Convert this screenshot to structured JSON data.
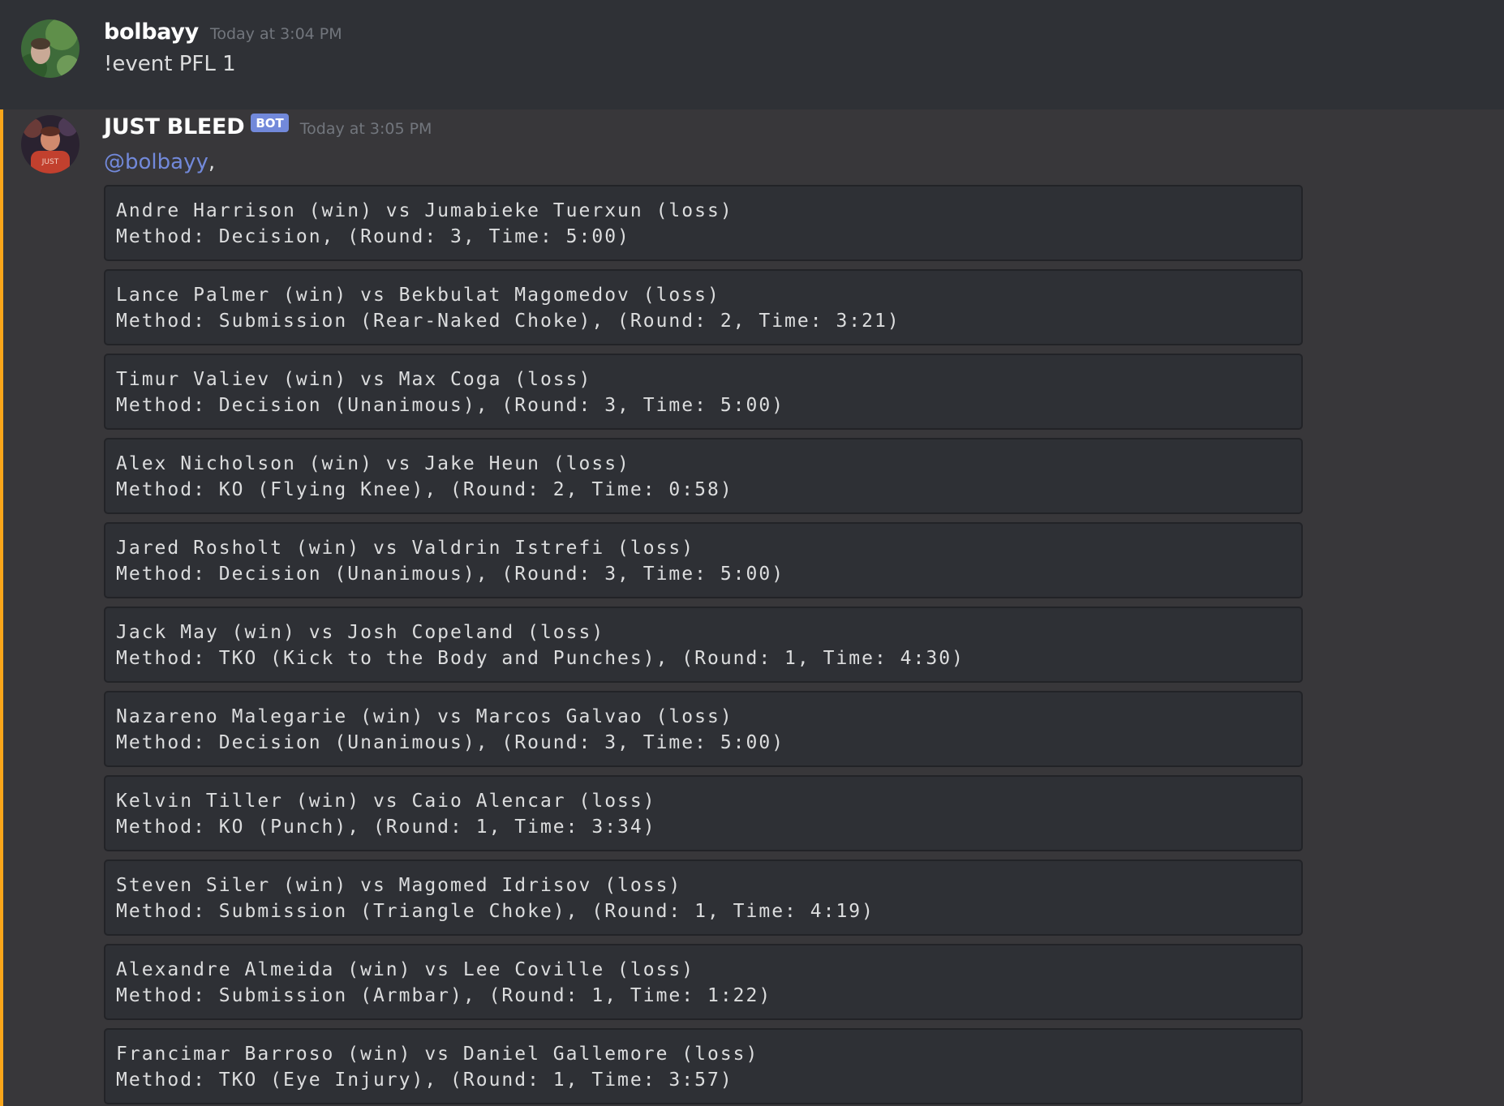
{
  "messages": [
    {
      "author": "bolbayy",
      "timestamp": "Today at 3:04 PM",
      "text": "!event PFL 1"
    },
    {
      "author": "JUST BLEED",
      "badge": "BOT",
      "timestamp": "Today at 3:05 PM",
      "mention": "@bolbayy",
      "mention_suffix": ",",
      "results": [
        {
          "fight": "Andre Harrison (win) vs Jumabieke Tuerxun (loss)",
          "method": "Method: Decision, (Round: 3, Time: 5:00)"
        },
        {
          "fight": "Lance Palmer (win) vs Bekbulat Magomedov (loss)",
          "method": "Method: Submission (Rear-Naked Choke), (Round: 2, Time: 3:21)"
        },
        {
          "fight": "Timur Valiev (win) vs Max Coga (loss)",
          "method": "Method: Decision (Unanimous), (Round: 3, Time: 5:00)"
        },
        {
          "fight": "Alex Nicholson (win) vs Jake Heun (loss)",
          "method": "Method: KO (Flying Knee), (Round: 2, Time: 0:58)"
        },
        {
          "fight": "Jared Rosholt (win) vs Valdrin Istrefi (loss)",
          "method": "Method: Decision (Unanimous), (Round: 3, Time: 5:00)"
        },
        {
          "fight": "Jack May (win) vs Josh Copeland (loss)",
          "method": "Method: TKO (Kick to the Body and Punches), (Round: 1, Time: 4:30)"
        },
        {
          "fight": "Nazareno Malegarie (win) vs Marcos Galvao (loss)",
          "method": "Method: Decision (Unanimous), (Round: 3, Time: 5:00)"
        },
        {
          "fight": "Kelvin Tiller (win) vs Caio Alencar (loss)",
          "method": "Method: KO (Punch), (Round: 1, Time: 3:34)"
        },
        {
          "fight": "Steven Siler (win) vs Magomed Idrisov (loss)",
          "method": "Method: Submission (Triangle Choke), (Round: 1, Time: 4:19)"
        },
        {
          "fight": "Alexandre Almeida (win) vs Lee Coville (loss)",
          "method": "Method: Submission (Armbar), (Round: 1, Time: 1:22)"
        },
        {
          "fight": "Francimar Barroso (win) vs Daniel Gallemore (loss)",
          "method": "Method: TKO (Eye Injury), (Round: 1, Time: 3:57)"
        }
      ]
    }
  ],
  "colors": {
    "background": "#36393f",
    "first_message_bg": "#2f3136",
    "mention_message_bg": "#38373a",
    "mention_bar": "#faa61a",
    "mention_text": "#7289da",
    "bot_badge": "#7289da",
    "codeblock_bg": "#2e3035"
  },
  "icons": {
    "bolbayy_avatar": "avatar-image",
    "bot_avatar": "avatar-image"
  }
}
